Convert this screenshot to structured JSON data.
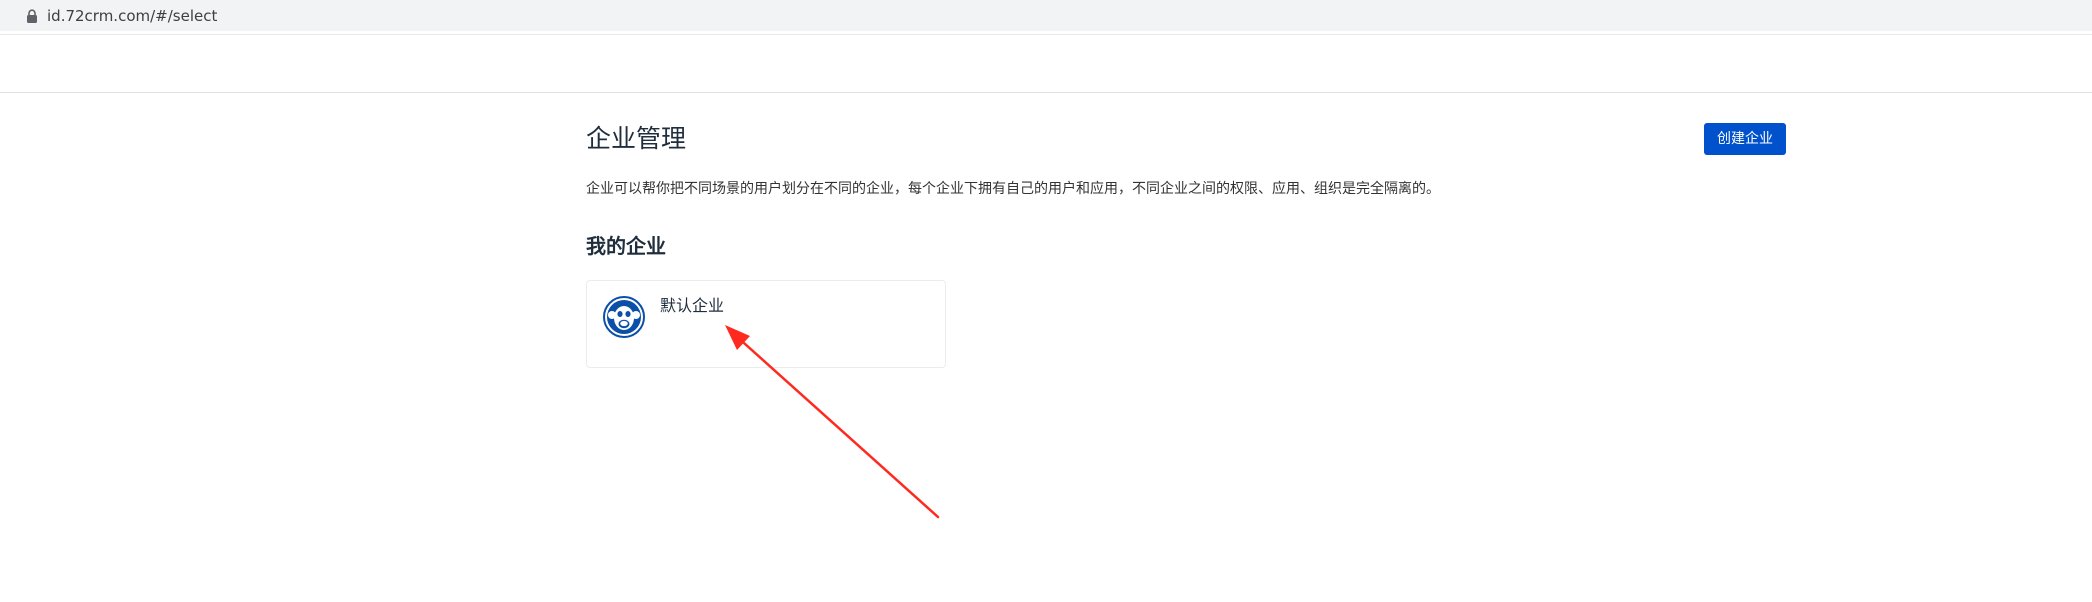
{
  "browser": {
    "url": "id.72crm.com/#/select",
    "lock_icon": "lock-icon"
  },
  "page": {
    "title": "企业管理",
    "create_button_label": "创建企业",
    "description": "企业可以帮你把不同场景的用户划分在不同的企业，每个企业下拥有自己的用户和应用，不同企业之间的权限、应用、组织是完全隔离的。",
    "section_title": "我的企业"
  },
  "companies": [
    {
      "name": "默认企业",
      "logo_icon": "monkey-logo-icon"
    }
  ],
  "colors": {
    "primary": "#0052cc",
    "annotation": "#ff2a1f"
  }
}
